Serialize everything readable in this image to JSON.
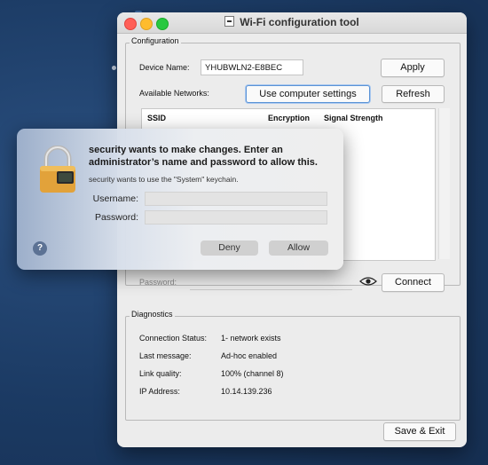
{
  "window": {
    "title": "Wi-Fi configuration tool"
  },
  "configuration": {
    "legend": "Configuration",
    "device_name_label": "Device Name:",
    "device_name_value": "YHUBWLN2-E8BEC",
    "apply_label": "Apply",
    "available_networks_label": "Available Networks:",
    "use_computer_settings_label": "Use computer settings",
    "refresh_label": "Refresh",
    "columns": [
      "SSID",
      "Encryption",
      "Signal Strength"
    ],
    "password_label": "Password:",
    "connect_label": "Connect"
  },
  "diagnostics": {
    "legend": "Diagnostics",
    "rows": [
      {
        "label": "Connection Status:",
        "value": "1- network exists"
      },
      {
        "label": "Last message:",
        "value": "Ad-hoc enabled"
      },
      {
        "label": "Link quality:",
        "value": "100% (channel 8)"
      },
      {
        "label": "IP Address:",
        "value": "10.14.139.236"
      }
    ]
  },
  "footer": {
    "save_exit_label": "Save & Exit"
  },
  "auth_dialog": {
    "title": "security wants to make changes. Enter an administrator’s name and password to allow this.",
    "subtitle": "security wants to use the \"System\" keychain.",
    "username_label": "Username:",
    "password_label": "Password:",
    "deny_label": "Deny",
    "allow_label": "Allow",
    "help_label": "?"
  },
  "colors": {
    "desktop": "#1b3a63",
    "lock_body": "#e2a23a",
    "focus_ring": "#5b93d6"
  }
}
